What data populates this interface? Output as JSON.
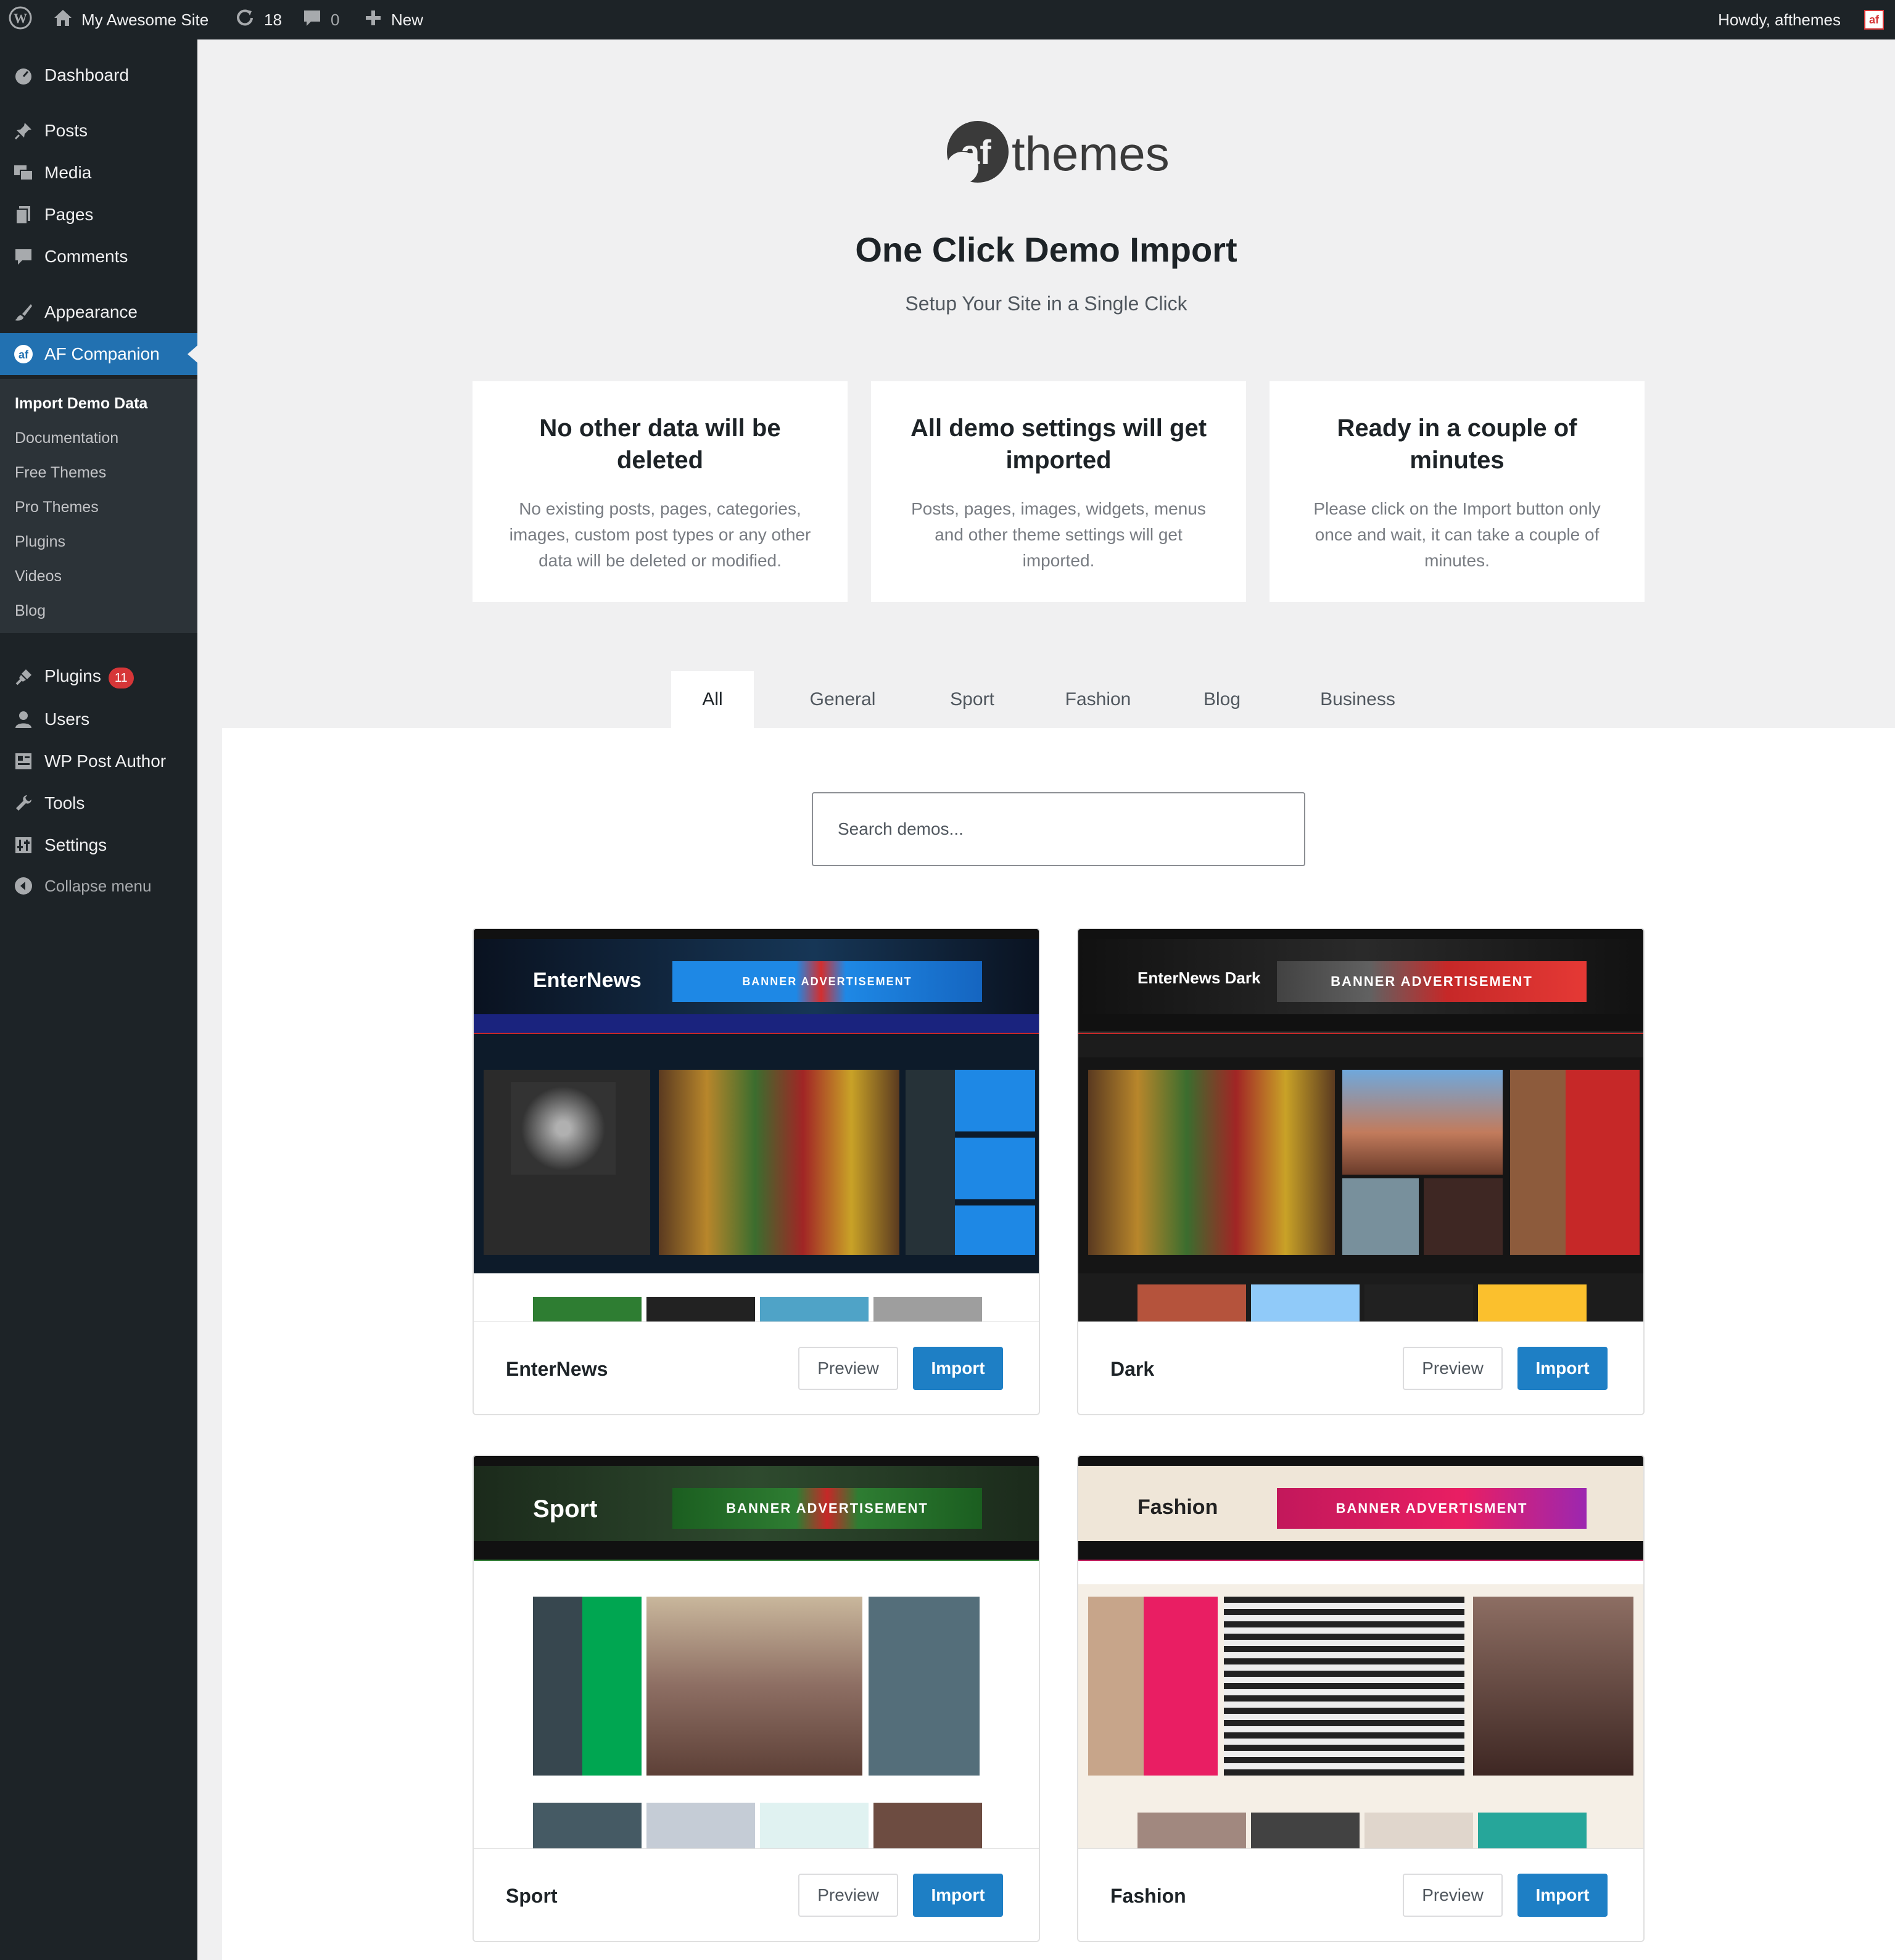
{
  "admin_bar": {
    "site_name": "My Awesome Site",
    "updates_count": "18",
    "comments_count": "0",
    "new_label": "New",
    "howdy": "Howdy, afthemes",
    "icons": [
      "wordpress-logo-icon",
      "home-icon",
      "refresh-icon",
      "comment-bubble-icon",
      "plus-icon"
    ]
  },
  "sidebar": {
    "items": [
      {
        "label": "Dashboard",
        "icon": "dashboard-gauge-icon"
      },
      {
        "label": "Posts",
        "icon": "pushpin-icon"
      },
      {
        "label": "Media",
        "icon": "media-icon"
      },
      {
        "label": "Pages",
        "icon": "pages-icon"
      },
      {
        "label": "Comments",
        "icon": "comment-icon"
      },
      {
        "label": "Appearance",
        "icon": "paintbrush-icon"
      },
      {
        "label": "AF Companion",
        "icon": "af-logo-icon"
      },
      {
        "label": "Plugins",
        "icon": "plugin-icon",
        "badge": "11"
      },
      {
        "label": "Users",
        "icon": "users-icon"
      },
      {
        "label": "WP Post Author",
        "icon": "author-icon"
      },
      {
        "label": "Tools",
        "icon": "wrench-icon"
      },
      {
        "label": "Settings",
        "icon": "settings-sliders-icon"
      },
      {
        "label": "Collapse menu",
        "icon": "collapse-arrow-icon"
      }
    ],
    "submenu": [
      "Import Demo Data",
      "Documentation",
      "Free Themes",
      "Pro Themes",
      "Plugins",
      "Videos",
      "Blog"
    ]
  },
  "logo": {
    "mark": "af",
    "word": "themes"
  },
  "header": {
    "title": "One Click Demo Import",
    "subtitle": "Setup Your Site in a Single Click"
  },
  "features": [
    {
      "title": "No other data will be deleted",
      "text": "No existing posts, pages, categories, images, custom post types or any other data will be deleted or modified."
    },
    {
      "title": "All demo settings will get imported",
      "text": "Posts, pages, images, widgets, menus and other theme settings will get imported."
    },
    {
      "title": "Ready in a couple of minutes",
      "text": "Please click on the Import button only once and wait, it can take a couple of minutes."
    }
  ],
  "tabs": [
    "All",
    "General",
    "Sport",
    "Fashion",
    "Blog",
    "Business"
  ],
  "active_tab": "All",
  "search": {
    "placeholder": "Search demos..."
  },
  "demos": [
    {
      "name": "EnterNews",
      "logo_text": "EnterNews",
      "banner_text": "BANNER ADVERTISEMENT",
      "theme": "dark-blue"
    },
    {
      "name": "Dark",
      "logo_text": "EnterNews Dark",
      "banner_text": "BANNER ADVERTISEMENT",
      "theme": "dark"
    },
    {
      "name": "Sport",
      "logo_text": "Sport",
      "banner_text": "BANNER ADVERTISEMENT",
      "theme": "green"
    },
    {
      "name": "Fashion",
      "logo_text": "Fashion",
      "banner_text": "BANNER ADVERTISMENT",
      "theme": "magenta"
    }
  ],
  "buttons": {
    "preview": "Preview",
    "import": "Import"
  },
  "colors": {
    "admin_bg": "#1d2327",
    "accent": "#2271b1",
    "import_button": "#1e7fc5",
    "badge": "#d63638"
  }
}
